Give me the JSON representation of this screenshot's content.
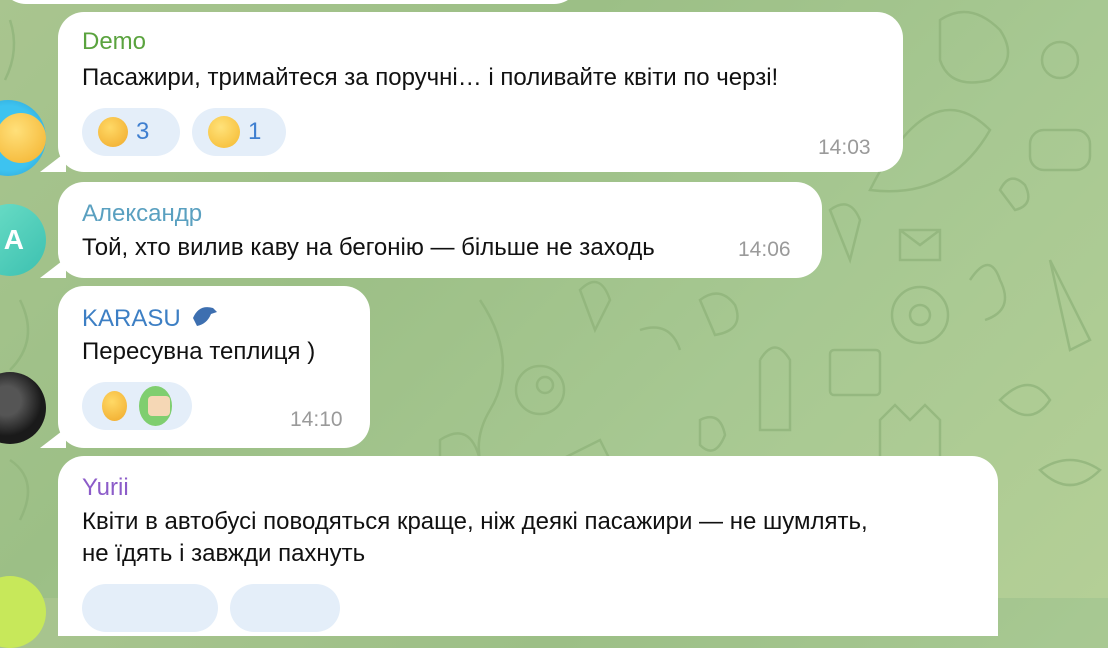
{
  "messages": [
    {
      "sender": "Demo",
      "sender_color": "#5aa33e",
      "text": "Пасажири, тримайтеся за поручні… і поливайте квіти по черзі!",
      "time": "14:03",
      "reactions": [
        {
          "emoji": "thumbs-up-icon",
          "count": "3"
        },
        {
          "emoji": "grinning-face-icon",
          "count": "1"
        }
      ]
    },
    {
      "sender": "Александр",
      "sender_color": "#5aa0c0",
      "avatar_letter": "A",
      "text": "Той, хто вилив каву на бегонію — більше не заходь",
      "time": "14:06"
    },
    {
      "sender": "KARASU",
      "sender_color": "#3d7fc4",
      "text": "Пересувна теплиця )",
      "time": "14:10",
      "reactions": [
        {
          "emoji": "thumbs-up-icon"
        },
        {
          "emoji": "sticker-avatar-icon"
        }
      ]
    },
    {
      "sender": "Yurii",
      "sender_color": "#8c5cc9",
      "text_line1": "Квіти в автобусі поводяться краще, ніж деякі пасажири — не шумлять,",
      "text_line2": "не їдять і завжди пахнуть"
    }
  ]
}
